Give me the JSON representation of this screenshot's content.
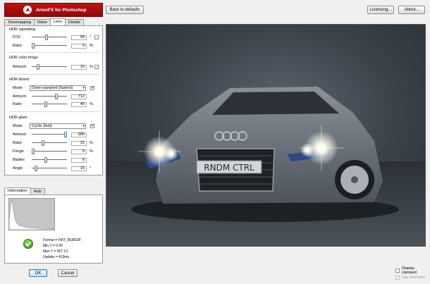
{
  "app": {
    "title": "ArionFX for Photoshop"
  },
  "header": {
    "back_to_defaults": "Back to defaults",
    "licensing": "Licensing...",
    "about": "About..."
  },
  "tabs": [
    {
      "label": "Tonemapping"
    },
    {
      "label": "Noise"
    },
    {
      "label": "Lens",
      "active": true
    },
    {
      "label": "Details"
    }
  ],
  "lens": {
    "vignetting": {
      "title": "HDR vignetting",
      "fov": {
        "label": "FOV",
        "value": "54",
        "unit": "°",
        "level": 0.42
      },
      "ratio": {
        "label": "Ratio",
        "value": "0",
        "unit": "%",
        "level": 0.0
      }
    },
    "fringe": {
      "title": "HDR color fringe",
      "amount": {
        "label": "Amount",
        "value": "16",
        "unit": "%",
        "level": 0.16
      }
    },
    "bloom": {
      "title": "HDR bloom",
      "mode_label": "Mode",
      "mode_value": "Down-sampled (fastest)",
      "enabled": true,
      "amount": {
        "label": "Amount",
        "value": "712",
        "level": 0.71
      },
      "ratio": {
        "label": "Ratio",
        "value": "40",
        "unit": "%",
        "level": 0.4
      }
    },
    "glare": {
      "title": "HDR glare",
      "mode_label": "Mode",
      "mode_value": "Cyclic (fast)",
      "enabled": true,
      "amount": {
        "label": "Amount",
        "value": "990",
        "level": 0.99
      },
      "ratio": {
        "label": "Ratio",
        "value": "31",
        "unit": "%",
        "level": 0.31
      },
      "fringe": {
        "label": "Fringe",
        "value": "0",
        "unit": "%",
        "level": 0.0
      },
      "blades": {
        "label": "Blades",
        "value": "6",
        "level": 0.4
      },
      "angle": {
        "label": "Angle",
        "value": "15",
        "unit": "°",
        "level": 0.08
      }
    }
  },
  "info_tabs": [
    {
      "label": "Information",
      "active": true
    },
    {
      "label": "Help"
    }
  ],
  "info": {
    "format": "Format = FMT_RGB32F",
    "min_y": "Min Y = 0.00",
    "max_y": "Max Y = 567.13",
    "update": "Update = 413ms"
  },
  "preview": {
    "plate": "RNDM CTRL"
  },
  "footer": {
    "ok": "OK",
    "cancel": "Cancel",
    "display_clamped": "Display clamped",
    "use_selection": "Use selection"
  },
  "colors": {
    "accent_red": "#b81212",
    "ok_icon_green": "#3a9a1e"
  }
}
